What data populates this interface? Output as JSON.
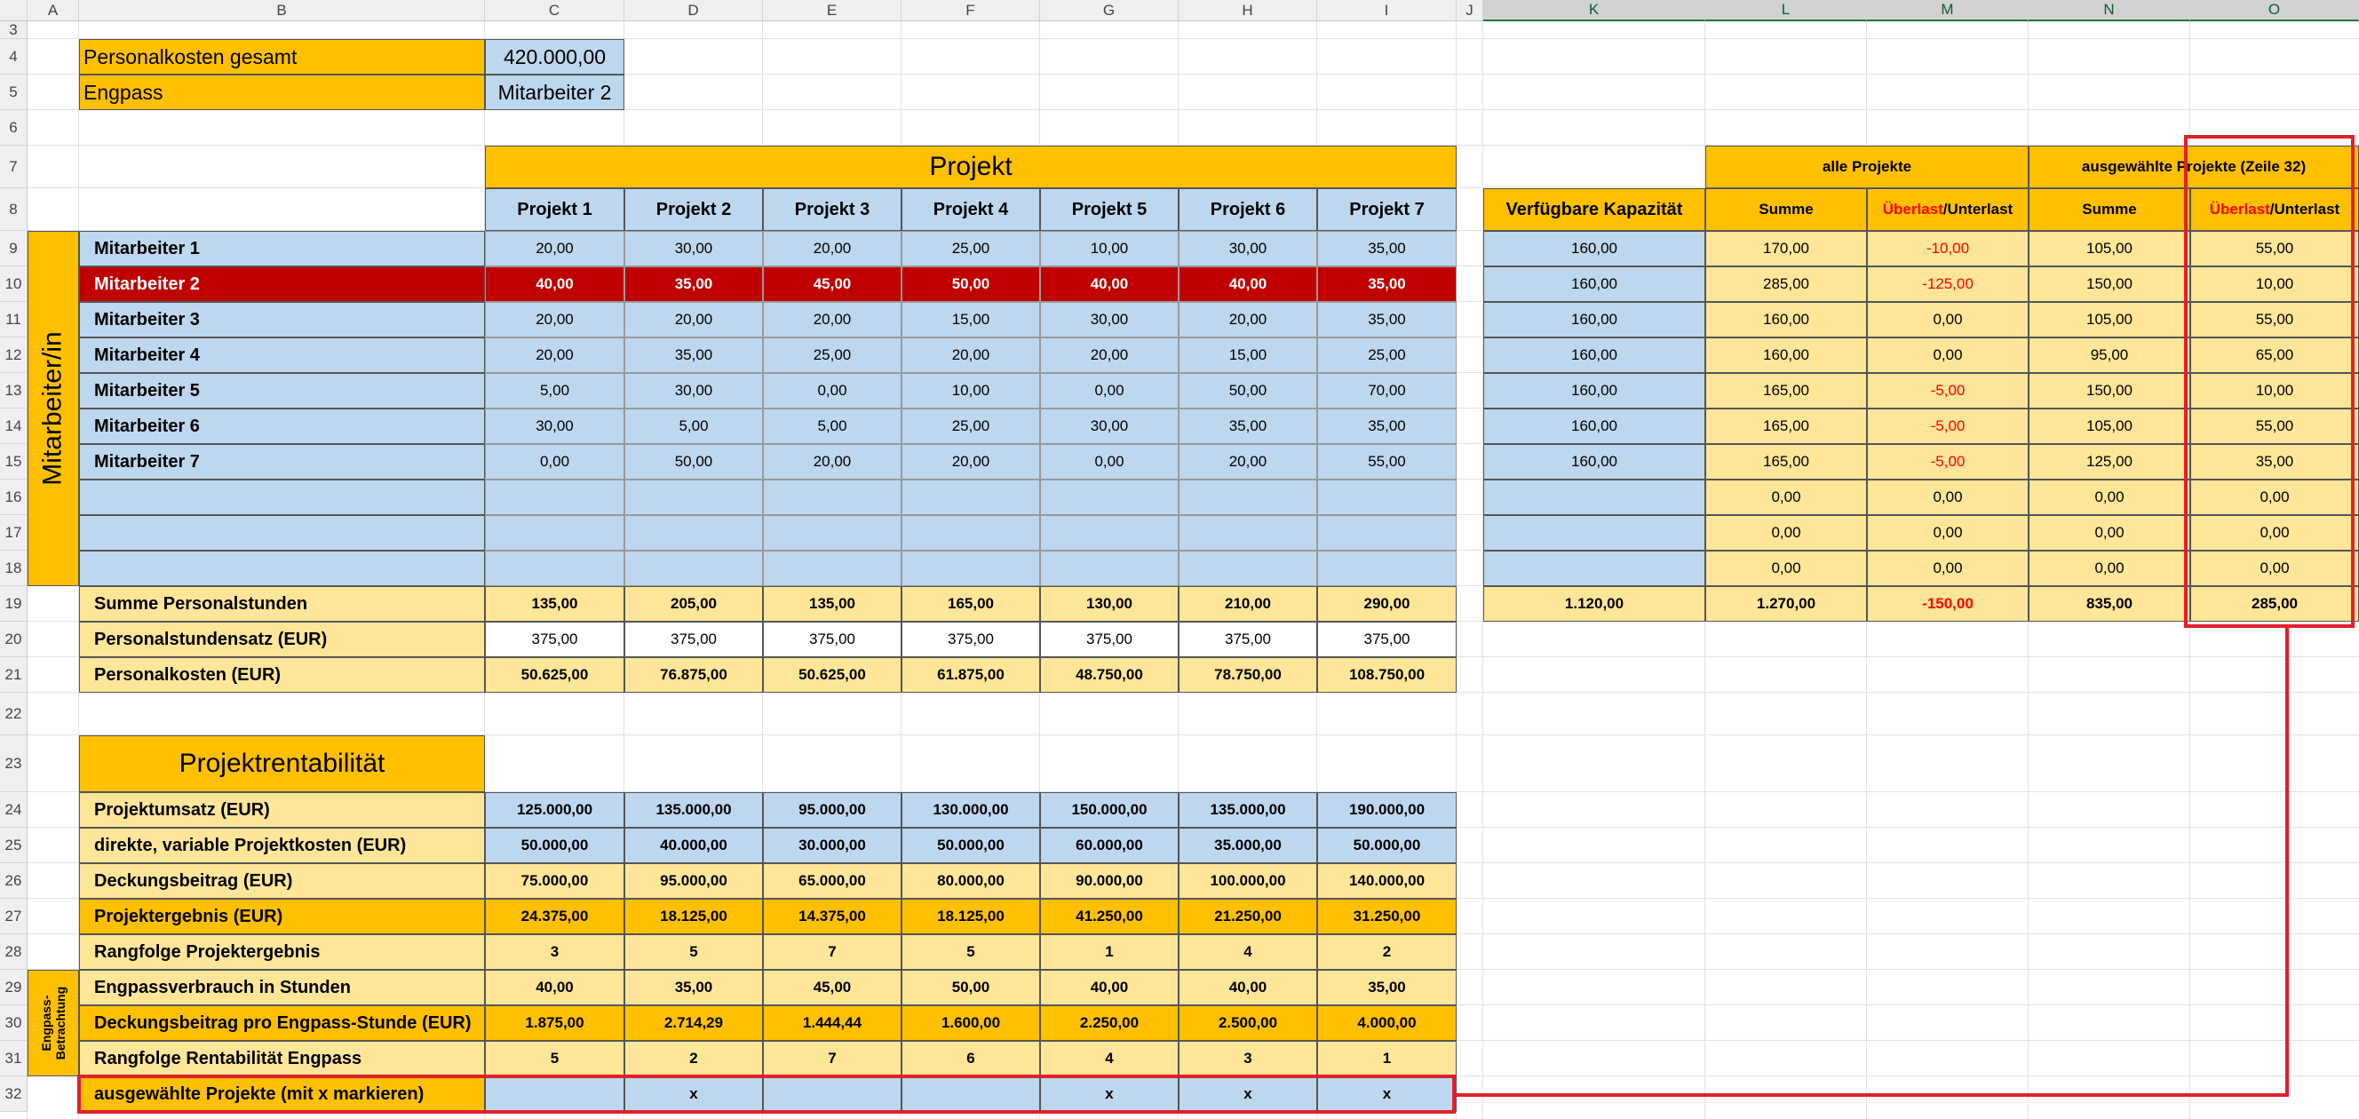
{
  "column_headers": [
    "A",
    "B",
    "C",
    "D",
    "E",
    "F",
    "G",
    "H",
    "I",
    "J",
    "K",
    "L",
    "M",
    "N",
    "O"
  ],
  "row_numbers": [
    "3",
    "4",
    "5",
    "6",
    "7",
    "8",
    "9",
    "10",
    "11",
    "12",
    "13",
    "14",
    "15",
    "16",
    "17",
    "18",
    "19",
    "20",
    "21",
    "22",
    "23",
    "24",
    "25",
    "26",
    "27",
    "28",
    "29",
    "30",
    "31",
    "32"
  ],
  "summary": {
    "personalkosten_label": "Personalkosten gesamt",
    "personalkosten_value": "420.000,00",
    "engpass_label": "Engpass",
    "engpass_value": "Mitarbeiter 2"
  },
  "section_titles": {
    "projekt": "Projekt",
    "mitarbeiter_vertical": "Mitarbeiter/in",
    "projektrentabilitaet": "Projektrentabilität",
    "engpass_vertical": "Engpass-\nBetrachtung",
    "verfuegbare_kapazitaet": "Verfügbare Kapazität",
    "alle_projekte": "alle Projekte",
    "ausgewaehlte_projekte": "ausgewählte Projekte (Zeile 32)",
    "summe": "Summe",
    "ueberlast": "Überlast",
    "unterlast": "/Unterlast"
  },
  "projects": [
    "Projekt 1",
    "Projekt 2",
    "Projekt 3",
    "Projekt 4",
    "Projekt 5",
    "Projekt 6",
    "Projekt 7"
  ],
  "employees": [
    {
      "name": "Mitarbeiter 1",
      "hours": [
        "20,00",
        "30,00",
        "20,00",
        "25,00",
        "10,00",
        "30,00",
        "35,00"
      ],
      "kap": "160,00",
      "sum_all": "170,00",
      "diff_all": "-10,00",
      "sum_sel": "105,00",
      "diff_sel": "55,00"
    },
    {
      "name": "Mitarbeiter 2",
      "hours": [
        "40,00",
        "35,00",
        "45,00",
        "50,00",
        "40,00",
        "40,00",
        "35,00"
      ],
      "kap": "160,00",
      "sum_all": "285,00",
      "diff_all": "-125,00",
      "sum_sel": "150,00",
      "diff_sel": "10,00"
    },
    {
      "name": "Mitarbeiter 3",
      "hours": [
        "20,00",
        "20,00",
        "20,00",
        "15,00",
        "30,00",
        "20,00",
        "35,00"
      ],
      "kap": "160,00",
      "sum_all": "160,00",
      "diff_all": "0,00",
      "sum_sel": "105,00",
      "diff_sel": "55,00"
    },
    {
      "name": "Mitarbeiter 4",
      "hours": [
        "20,00",
        "35,00",
        "25,00",
        "20,00",
        "20,00",
        "15,00",
        "25,00"
      ],
      "kap": "160,00",
      "sum_all": "160,00",
      "diff_all": "0,00",
      "sum_sel": "95,00",
      "diff_sel": "65,00"
    },
    {
      "name": "Mitarbeiter 5",
      "hours": [
        "5,00",
        "30,00",
        "0,00",
        "10,00",
        "0,00",
        "50,00",
        "70,00"
      ],
      "kap": "160,00",
      "sum_all": "165,00",
      "diff_all": "-5,00",
      "sum_sel": "150,00",
      "diff_sel": "10,00"
    },
    {
      "name": "Mitarbeiter 6",
      "hours": [
        "30,00",
        "5,00",
        "5,00",
        "25,00",
        "30,00",
        "35,00",
        "35,00"
      ],
      "kap": "160,00",
      "sum_all": "165,00",
      "diff_all": "-5,00",
      "sum_sel": "105,00",
      "diff_sel": "55,00"
    },
    {
      "name": "Mitarbeiter 7",
      "hours": [
        "0,00",
        "50,00",
        "20,00",
        "20,00",
        "0,00",
        "20,00",
        "55,00"
      ],
      "kap": "160,00",
      "sum_all": "165,00",
      "diff_all": "-5,00",
      "sum_sel": "125,00",
      "diff_sel": "35,00"
    },
    {
      "name": "",
      "hours": [
        "",
        "",
        "",
        "",
        "",
        "",
        ""
      ],
      "kap": "",
      "sum_all": "0,00",
      "diff_all": "0,00",
      "sum_sel": "0,00",
      "diff_sel": "0,00"
    },
    {
      "name": "",
      "hours": [
        "",
        "",
        "",
        "",
        "",
        "",
        ""
      ],
      "kap": "",
      "sum_all": "0,00",
      "diff_all": "0,00",
      "sum_sel": "0,00",
      "diff_sel": "0,00"
    },
    {
      "name": "",
      "hours": [
        "",
        "",
        "",
        "",
        "",
        "",
        ""
      ],
      "kap": "",
      "sum_all": "0,00",
      "diff_all": "0,00",
      "sum_sel": "0,00",
      "diff_sel": "0,00"
    }
  ],
  "totals": {
    "summe_label": "Summe Personalstunden",
    "summe": [
      "135,00",
      "205,00",
      "135,00",
      "165,00",
      "130,00",
      "210,00",
      "290,00"
    ],
    "kap_total": "1.120,00",
    "sum_all_total": "1.270,00",
    "diff_all_total": "-150,00",
    "sum_sel_total": "835,00",
    "diff_sel_total": "285,00",
    "satz_label": "Personalstundensatz (EUR)",
    "satz": [
      "375,00",
      "375,00",
      "375,00",
      "375,00",
      "375,00",
      "375,00",
      "375,00"
    ],
    "kosten_label": "Personalkosten (EUR)",
    "kosten": [
      "50.625,00",
      "76.875,00",
      "50.625,00",
      "61.875,00",
      "48.750,00",
      "78.750,00",
      "108.750,00"
    ]
  },
  "rentability_rows": [
    {
      "label": "Projektumsatz (EUR)",
      "values": [
        "125.000,00",
        "135.000,00",
        "95.000,00",
        "130.000,00",
        "150.000,00",
        "135.000,00",
        "190.000,00"
      ]
    },
    {
      "label": "direkte, variable Projektkosten (EUR)",
      "values": [
        "50.000,00",
        "40.000,00",
        "30.000,00",
        "50.000,00",
        "60.000,00",
        "35.000,00",
        "50.000,00"
      ]
    },
    {
      "label": "Deckungsbeitrag (EUR)",
      "values": [
        "75.000,00",
        "95.000,00",
        "65.000,00",
        "80.000,00",
        "90.000,00",
        "100.000,00",
        "140.000,00"
      ]
    },
    {
      "label": "Projektergebnis (EUR)",
      "values": [
        "24.375,00",
        "18.125,00",
        "14.375,00",
        "18.125,00",
        "41.250,00",
        "21.250,00",
        "31.250,00"
      ]
    },
    {
      "label": "Rangfolge Projektergebnis",
      "values": [
        "3",
        "5",
        "7",
        "5",
        "1",
        "4",
        "2"
      ]
    },
    {
      "label": "Engpassverbrauch in Stunden",
      "values": [
        "40,00",
        "35,00",
        "45,00",
        "50,00",
        "40,00",
        "40,00",
        "35,00"
      ]
    },
    {
      "label": "Deckungsbeitrag pro Engpass-Stunde (EUR)",
      "values": [
        "1.875,00",
        "2.714,29",
        "1.444,44",
        "1.600,00",
        "2.250,00",
        "2.500,00",
        "4.000,00"
      ]
    },
    {
      "label": "Rangfolge Rentabilität Engpass",
      "values": [
        "5",
        "2",
        "7",
        "6",
        "4",
        "3",
        "1"
      ]
    },
    {
      "label": "ausgewählte Projekte (mit x markieren)",
      "values": [
        "",
        "x",
        "",
        "",
        "x",
        "x",
        "x"
      ]
    }
  ],
  "colors": {
    "orange": "#ffc000",
    "light_orange": "#ffe699",
    "light_blue": "#bdd7ee",
    "dark_red": "#c00000",
    "highlight_red": "#e0202b",
    "negative_red": "#ff0000",
    "header_gray": "#efefef"
  }
}
